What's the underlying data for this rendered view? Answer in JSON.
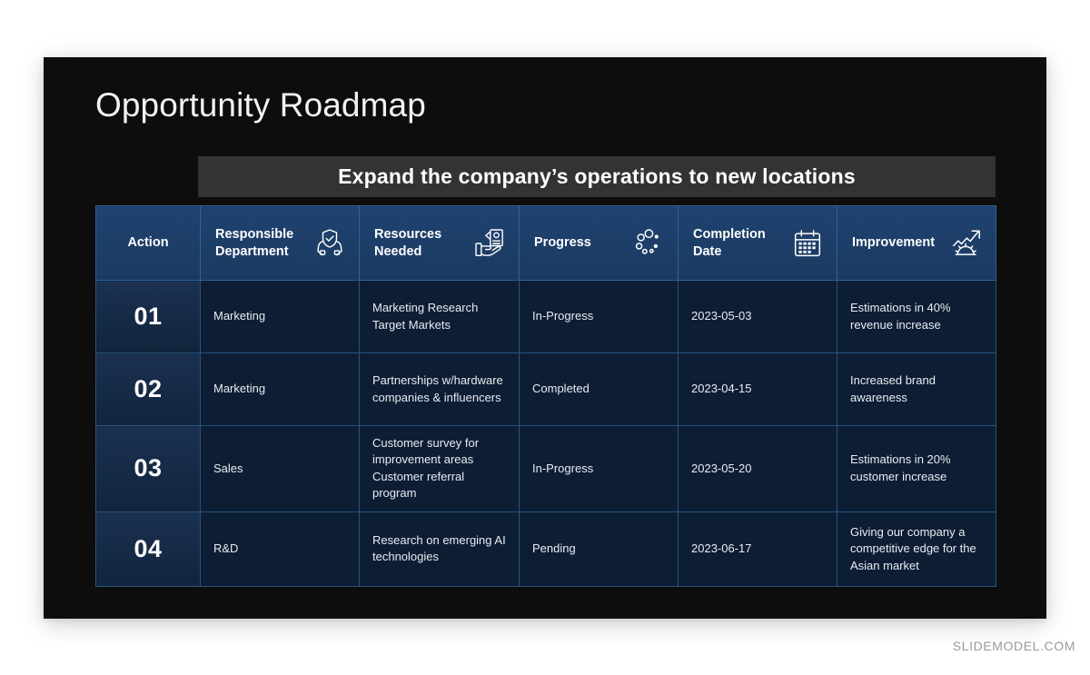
{
  "slide": {
    "title": "Opportunity Roadmap",
    "banner_text": "Expand the company’s operations to new locations",
    "background_color": "#0d0d0d",
    "banner_color": "#333333",
    "header_color": "#1b3a60",
    "cell_color": "#0d1d33",
    "border_color": "#27547f"
  },
  "table": {
    "headers": [
      {
        "label": "Action",
        "icon": "none"
      },
      {
        "label": "Responsible\nDepartment",
        "icon": "shield-hands-icon"
      },
      {
        "label": "Resources\nNeeded",
        "icon": "hand-card-icon"
      },
      {
        "label": "Progress",
        "icon": "progress-dots-icon"
      },
      {
        "label": "Completion\nDate",
        "icon": "calendar-icon"
      },
      {
        "label": "Improvement",
        "icon": "growth-gear-icon"
      }
    ],
    "rows": [
      {
        "action": "01",
        "department": "Marketing",
        "resources": "Marketing Research\nTarget Markets",
        "progress": "In-Progress",
        "completion_date": "2023-05-03",
        "improvement": "Estimations in 40%\nrevenue increase"
      },
      {
        "action": "02",
        "department": "Marketing",
        "resources": "Partnerships w/hardware\ncompanies & influencers",
        "progress": "Completed",
        "completion_date": "2023-04-15",
        "improvement": "Increased brand\nawareness"
      },
      {
        "action": "03",
        "department": "Sales",
        "resources": "Customer survey for\nimprovement areas\nCustomer referral\nprogram",
        "progress": "In-Progress",
        "completion_date": "2023-05-20",
        "improvement": "Estimations in 20%\ncustomer increase"
      },
      {
        "action": "04",
        "department": "R&D",
        "resources": "Research on emerging AI\ntechnologies",
        "progress": "Pending",
        "completion_date": "2023-06-17",
        "improvement": "Giving our company a\ncompetitive edge for the\nAsian market"
      }
    ]
  },
  "watermark": "SLIDEMODEL.COM"
}
